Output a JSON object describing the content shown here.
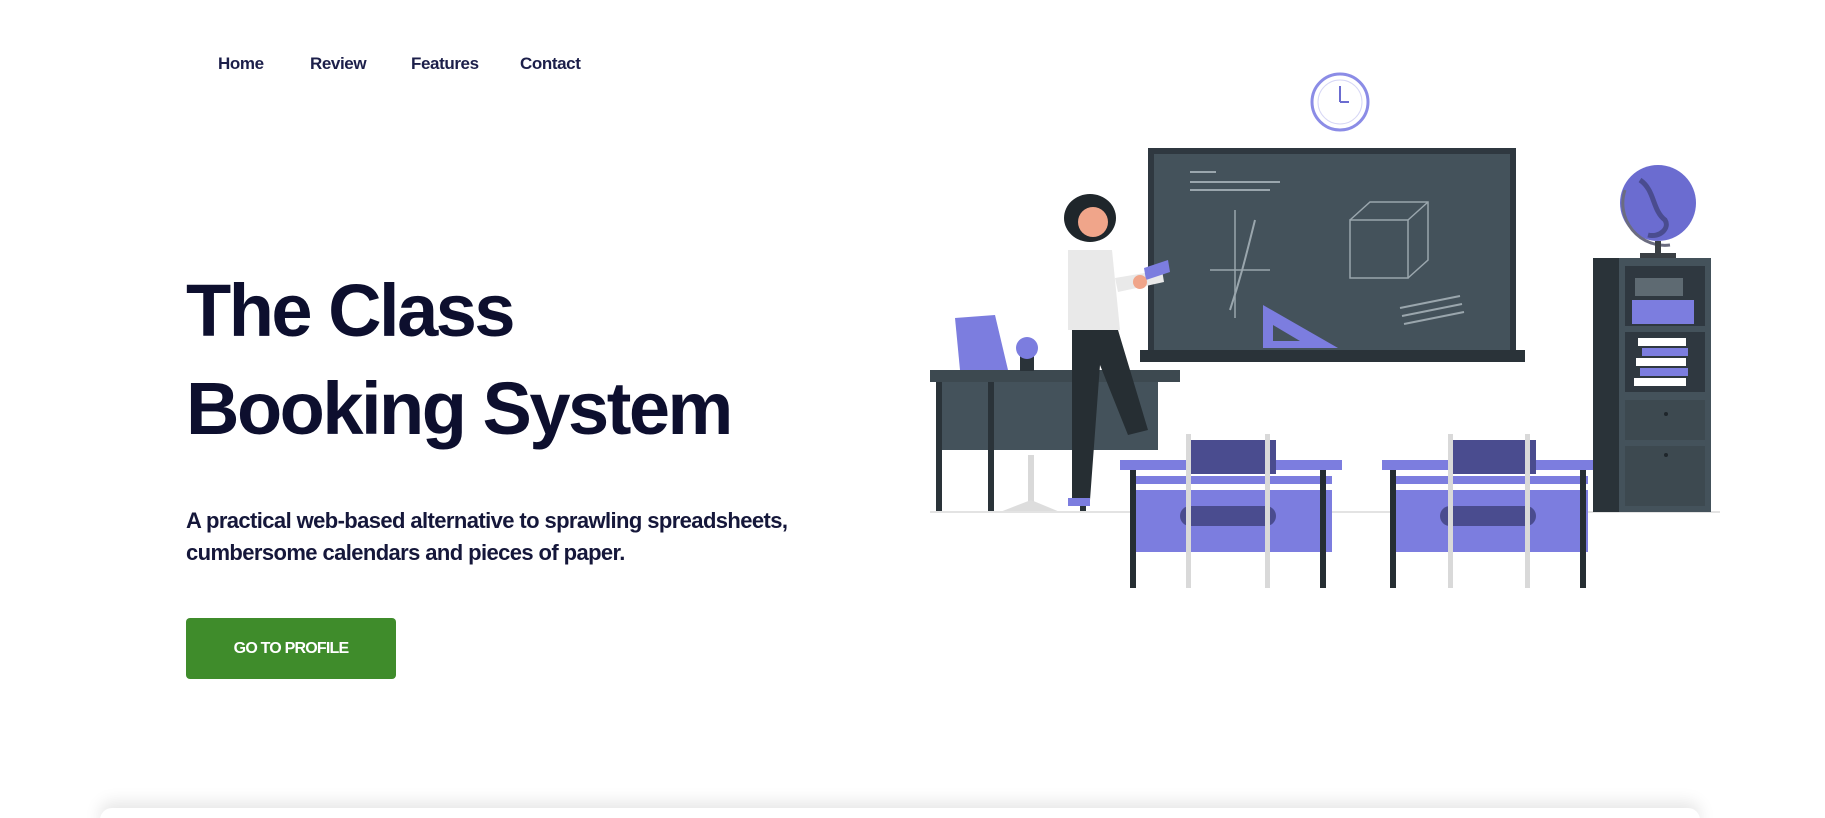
{
  "nav": {
    "items": [
      {
        "label": "Home"
      },
      {
        "label": "Review"
      },
      {
        "label": "Features"
      },
      {
        "label": "Contact"
      }
    ]
  },
  "hero": {
    "title": "The Class Booking System",
    "subtitle": "A practical web-based alternative to sprawling spreadsheets, cumbersome calendars and pieces of paper.",
    "cta_label": "GO TO PROFILE"
  },
  "colors": {
    "accent": "#3f8c2b",
    "text_dark": "#0d0f2e",
    "illustration_purple": "#7c7ddf",
    "chalkboard": "#3f4b53"
  },
  "icons": {
    "illustration": "classroom-teacher-illustration"
  }
}
